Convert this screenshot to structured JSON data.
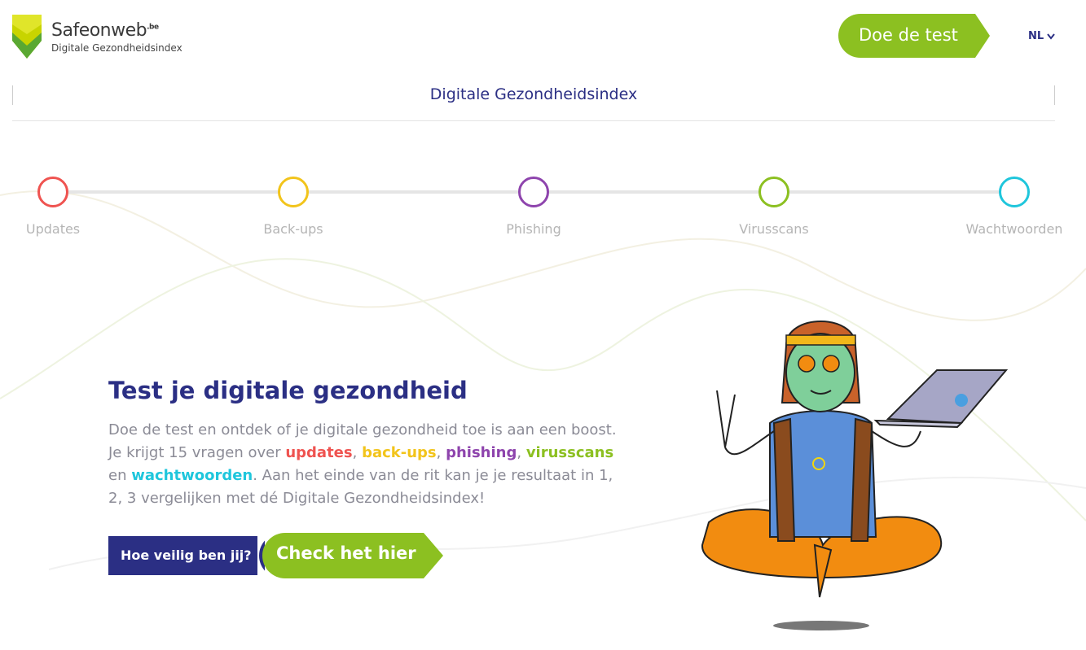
{
  "header": {
    "brand": "Safeonweb",
    "brand_suffix": ".be",
    "brand_sub": "Digitale Gezondheidsindex",
    "cta_label": "Doe de test",
    "language": "NL"
  },
  "sub_nav": {
    "title": "Digitale Gezondheidsindex"
  },
  "steps": [
    {
      "label": "Updates",
      "color": "#ef5350"
    },
    {
      "label": "Back-ups",
      "color": "#f2c41b"
    },
    {
      "label": "Phishing",
      "color": "#8e44ad"
    },
    {
      "label": "Virusscans",
      "color": "#8cc021"
    },
    {
      "label": "Wachtwoorden",
      "color": "#1fc6dc"
    }
  ],
  "hero": {
    "title": "Test je digitale gezondheid",
    "body_part1": "Doe de test en ontdek of je digitale gezondheid toe is aan een boost. Je krijgt 15 vragen over ",
    "kw_updates": "updates",
    "sep1": ", ",
    "kw_backups": "back-ups",
    "sep2": ", ",
    "kw_phishing": "phishing",
    "sep3": ", ",
    "kw_virusscans": "virusscans",
    "sep4": " en ",
    "kw_wachtwoorden": "wachtwoorden",
    "body_part2": ". Aan het einde van de rit kan je je resultaat in 1, 2, 3 vergelijken met dé Digitale Gezondheidsindex!",
    "question_label": "Hoe veilig ben jij?",
    "check_label": "Check het hier"
  },
  "colors": {
    "navy": "#2b2f84",
    "green": "#8cc021"
  }
}
